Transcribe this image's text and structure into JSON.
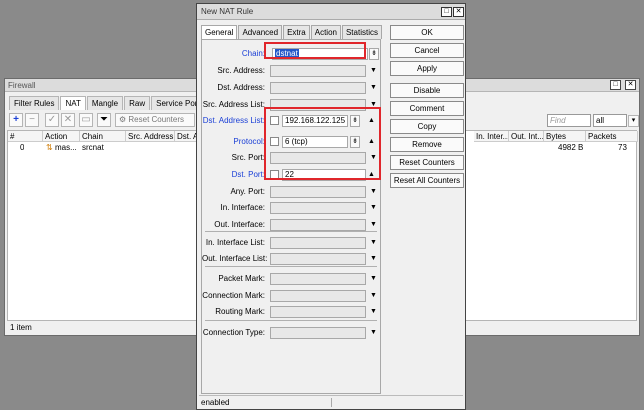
{
  "firewall": {
    "title": "Firewall",
    "tabs": [
      "Filter Rules",
      "NAT",
      "Mangle",
      "Raw",
      "Service Ports"
    ],
    "toolbar": {
      "reset_counters": "Reset Counters"
    },
    "search_placeholder": "Find",
    "filter_value": "all",
    "columns": [
      "#",
      "Action",
      "Chain",
      "Src. Address",
      "Dst. Ad",
      "In. Inter...",
      "Out. Int...",
      "Bytes",
      "Packets"
    ],
    "rows": [
      {
        "num": "0",
        "action": "mas...",
        "chain": "srcnat",
        "bytes": "4982 B",
        "packets": "73"
      }
    ],
    "status": "1 item"
  },
  "dialog": {
    "title": "New NAT Rule",
    "tabs": [
      "General",
      "Advanced",
      "Extra",
      "Action",
      "Statistics"
    ],
    "fields": {
      "chain": {
        "label": "Chain:",
        "value": "dstnat"
      },
      "src_address": {
        "label": "Src. Address:"
      },
      "dst_address": {
        "label": "Dst. Address:"
      },
      "src_address_list": {
        "label": "Src. Address List:"
      },
      "dst_address_list": {
        "label": "Dst. Address List:",
        "value": "192.168.122.125"
      },
      "protocol": {
        "label": "Protocol:",
        "value": "6 (tcp)"
      },
      "src_port": {
        "label": "Src. Port:"
      },
      "dst_port": {
        "label": "Dst. Port:",
        "value": "22"
      },
      "any_port": {
        "label": "Any. Port:"
      },
      "in_interface": {
        "label": "In. Interface:"
      },
      "out_interface": {
        "label": "Out. Interface:"
      },
      "in_interface_list": {
        "label": "In. Interface List:"
      },
      "out_interface_list": {
        "label": "Out. Interface List:"
      },
      "packet_mark": {
        "label": "Packet Mark:"
      },
      "connection_mark": {
        "label": "Connection Mark:"
      },
      "routing_mark": {
        "label": "Routing Mark:"
      },
      "connection_type": {
        "label": "Connection Type:"
      }
    },
    "buttons": [
      "OK",
      "Cancel",
      "Apply",
      "Disable",
      "Comment",
      "Copy",
      "Remove",
      "Reset Counters",
      "Reset All Counters"
    ],
    "status": "enabled"
  },
  "colors": {
    "highlight_box": "#e0262b",
    "blue_label": "#1a3fd6",
    "selection": "#2257c8"
  }
}
